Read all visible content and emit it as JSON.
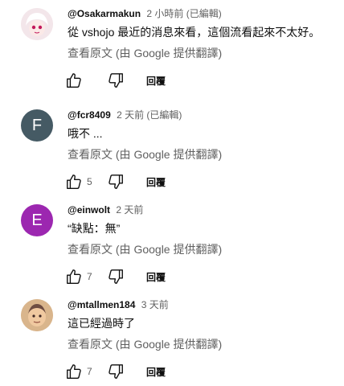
{
  "comments": [
    {
      "author": "@Osakarmakun",
      "time": "2 小時前 (已編輯)",
      "text": "從 vshojo 最近的消息來看，這個流看起來不太好。",
      "translate": "查看原文 (由 Google 提供翻譯)",
      "likes": "",
      "reply": "回覆",
      "avatar_color": "#f3e6ea",
      "avatar_letter": ""
    },
    {
      "author": "@fcr8409",
      "time": "2 天前 (已編輯)",
      "text": "哦不 ...",
      "translate": "查看原文 (由 Google 提供翻譯)",
      "likes": "5",
      "reply": "回覆",
      "avatar_color": "#455a64",
      "avatar_letter": "F"
    },
    {
      "author": "@einwolt",
      "time": "2 天前",
      "text": "“缺點：無”",
      "translate": "查看原文 (由 Google 提供翻譯)",
      "likes": "7",
      "reply": "回覆",
      "avatar_color": "#9c27b0",
      "avatar_letter": "E"
    },
    {
      "author": "@mtallmen184",
      "time": "3 天前",
      "text": "這已經過時了",
      "translate": "查看原文 (由 Google 提供翻譯)",
      "likes": "7",
      "reply": "回覆",
      "avatar_color": "#d9b58c",
      "avatar_letter": ""
    }
  ]
}
